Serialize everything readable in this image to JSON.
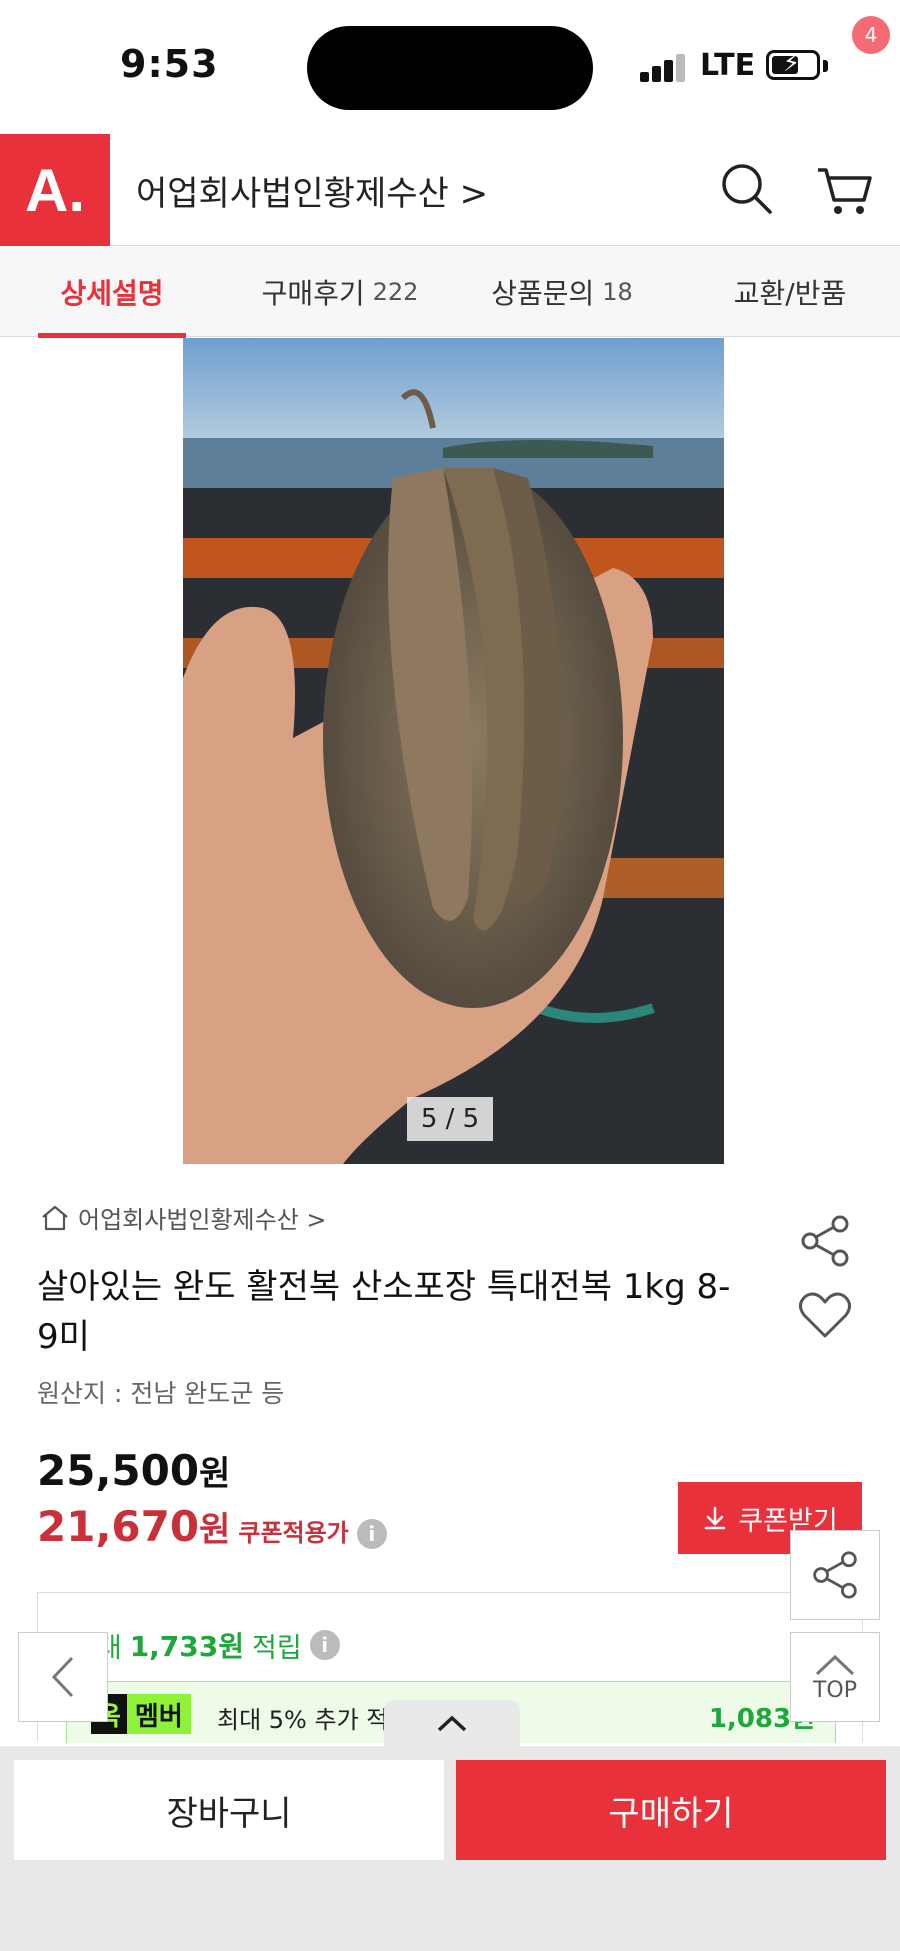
{
  "status": {
    "time": "9:53",
    "network": "LTE"
  },
  "header": {
    "logo": "A.",
    "shop_name": "어업회사법인황제수산 >",
    "cart_count": "4"
  },
  "tabs": [
    {
      "label": "상세설명",
      "count": ""
    },
    {
      "label": "구매후기",
      "count": "222"
    },
    {
      "label": "상품문의",
      "count": "18"
    },
    {
      "label": "교환/반품",
      "count": ""
    }
  ],
  "gallery": {
    "counter": "5 / 5"
  },
  "product": {
    "shop_link": "어업회사법인황제수산 >",
    "title": "살아있는 완도 활전복 산소포장 특대전복 1kg 8-9미",
    "origin": "원산지 : 전남 완도군 등",
    "price": "25,500",
    "price_unit": "원",
    "coupon_price": "21,670",
    "coupon_price_unit": "원",
    "coupon_price_label": "쿠폰적용가",
    "coupon_button": "쿠폰받기"
  },
  "points": {
    "prefix": "최대",
    "amount": "1,733원",
    "suffix": "적립",
    "member_badge_a": "옥",
    "member_badge_b": "멤버",
    "member_text": "최대 5% 추가 적",
    "member_value": "1,083원"
  },
  "floating": {
    "top_label": "TOP"
  },
  "bottom_bar": {
    "cart": "장바구니",
    "buy": "구매하기"
  },
  "colors": {
    "brand": "#e8313b",
    "points": "#1fa83a"
  }
}
